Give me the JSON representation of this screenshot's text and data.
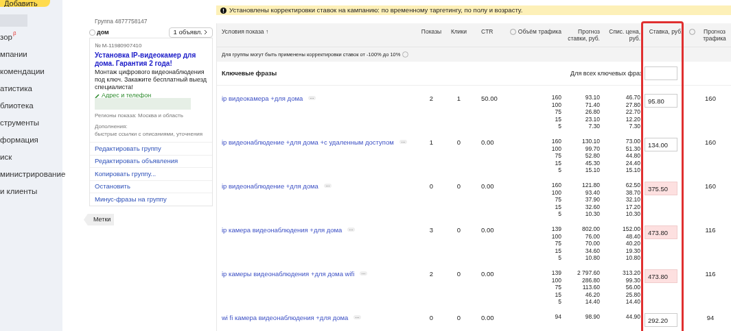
{
  "sidebar": {
    "add_button": "Добавить",
    "items": [
      {
        "label": "зор",
        "badge": "β"
      },
      {
        "label": "мпании"
      },
      {
        "label": "комендации"
      },
      {
        "label": "атистика"
      },
      {
        "label": "блиотека"
      },
      {
        "label": "струменты"
      },
      {
        "label": "формация"
      },
      {
        "label": "иск"
      },
      {
        "label": "министрирование"
      },
      {
        "label": "и клиенты"
      }
    ]
  },
  "group": {
    "title": "Группа 4877758147",
    "checked": false,
    "name": "дом",
    "ads_button": "1 объявл.",
    "ad_number": "№ M-11980907410",
    "ad_title": "Установка IP-видеокамер для дома. Гарантия 2 года!",
    "ad_text": "Монтаж цифрового видеонаблюдения под ключ. Закажите бесплатный выезд специалиста!",
    "contact_link": "Адрес и телефон",
    "regions": "Регионы показа: Москва и область",
    "extras_label": "Дополнения:",
    "extras": "быстрые ссылки с описаниями, уточнения",
    "actions": [
      "Редактировать группу",
      "Редактировать объявления",
      "Копировать группу...",
      "Остановить",
      "Минус-фразы на группу"
    ],
    "tag": "Метки"
  },
  "alert": "Установлены корректировки ставок на кампанию: по временному таргетингу, по полу и возрасту.",
  "table": {
    "columns": [
      {
        "label": "Условия показа",
        "sort": "↑"
      },
      {
        "label": "Показы"
      },
      {
        "label": "Клики"
      },
      {
        "label": "CTR"
      },
      {
        "label": "Объём трафика",
        "help": true
      },
      {
        "label": "Прогноз ставки, руб."
      },
      {
        "label": "Спис. цена, руб."
      },
      {
        "label": "Ставка, руб."
      },
      {
        "label": "Прогноз трафика",
        "help": true
      }
    ],
    "note": "Для группы могут быть применены корректировки ставок от -100% до 10%",
    "section": "Ключевые фразы",
    "all_label": "Для всех ключевых фраз",
    "rows": [
      {
        "phrase": "ip видеокамера +для дома",
        "shows": "2",
        "clicks": "1",
        "ctr": "50.00",
        "traffic": [
          "160",
          "100",
          "75",
          "15",
          "5"
        ],
        "forecast": [
          "93.10",
          "71.40",
          "26.80",
          "23.10",
          "7.30"
        ],
        "price": [
          "46.70",
          "27.80",
          "22.70",
          "12.20",
          "7.30"
        ],
        "bid": "95.80",
        "error": false,
        "traffic_forecast": "160"
      },
      {
        "phrase": "ip видеонаблюдение +для дома +с удаленным доступом",
        "shows": "1",
        "clicks": "0",
        "ctr": "0.00",
        "traffic": [
          "160",
          "100",
          "75",
          "15",
          "5"
        ],
        "forecast": [
          "130.10",
          "99.70",
          "52.80",
          "45.30",
          "15.10"
        ],
        "price": [
          "73.00",
          "51.30",
          "44.80",
          "24.40",
          "15.10"
        ],
        "bid": "134.00",
        "error": false,
        "traffic_forecast": "160"
      },
      {
        "phrase": "ip видеонаблюдение +для дома",
        "shows": "0",
        "clicks": "0",
        "ctr": "0.00",
        "traffic": [
          "160",
          "100",
          "75",
          "15",
          "5"
        ],
        "forecast": [
          "121.80",
          "93.40",
          "37.90",
          "32.60",
          "10.30"
        ],
        "price": [
          "62.50",
          "38.70",
          "32.10",
          "17.20",
          "10.30"
        ],
        "bid": "375.50",
        "error": true,
        "traffic_forecast": "160"
      },
      {
        "phrase": "ip камера видеонаблюдения +для дома",
        "shows": "3",
        "clicks": "0",
        "ctr": "0.00",
        "traffic": [
          "139",
          "100",
          "75",
          "15",
          "5"
        ],
        "forecast": [
          "802.00",
          "76.00",
          "70.00",
          "34.60",
          "10.80"
        ],
        "price": [
          "152.00",
          "48.40",
          "40.20",
          "19.30",
          "10.80"
        ],
        "bid": "473.80",
        "error": true,
        "traffic_forecast": "116"
      },
      {
        "phrase": "ip камеры видеонаблюдения +для дома wifi",
        "shows": "2",
        "clicks": "0",
        "ctr": "0.00",
        "traffic": [
          "139",
          "100",
          "75",
          "15",
          "5"
        ],
        "forecast": [
          "2 797.60",
          "286.80",
          "113.60",
          "46.20",
          "14.40"
        ],
        "price": [
          "313.20",
          "99.30",
          "56.00",
          "25.80",
          "14.40"
        ],
        "bid": "473.80",
        "error": true,
        "traffic_forecast": "116"
      },
      {
        "phrase": "wi fi камера видеонаблюдения +для дома",
        "shows": "0",
        "clicks": "0",
        "ctr": "0.00",
        "traffic": [
          "94"
        ],
        "forecast": [
          "98.90"
        ],
        "price": [
          "44.90"
        ],
        "bid": "292.20",
        "error": false,
        "traffic_forecast": "94"
      }
    ]
  }
}
